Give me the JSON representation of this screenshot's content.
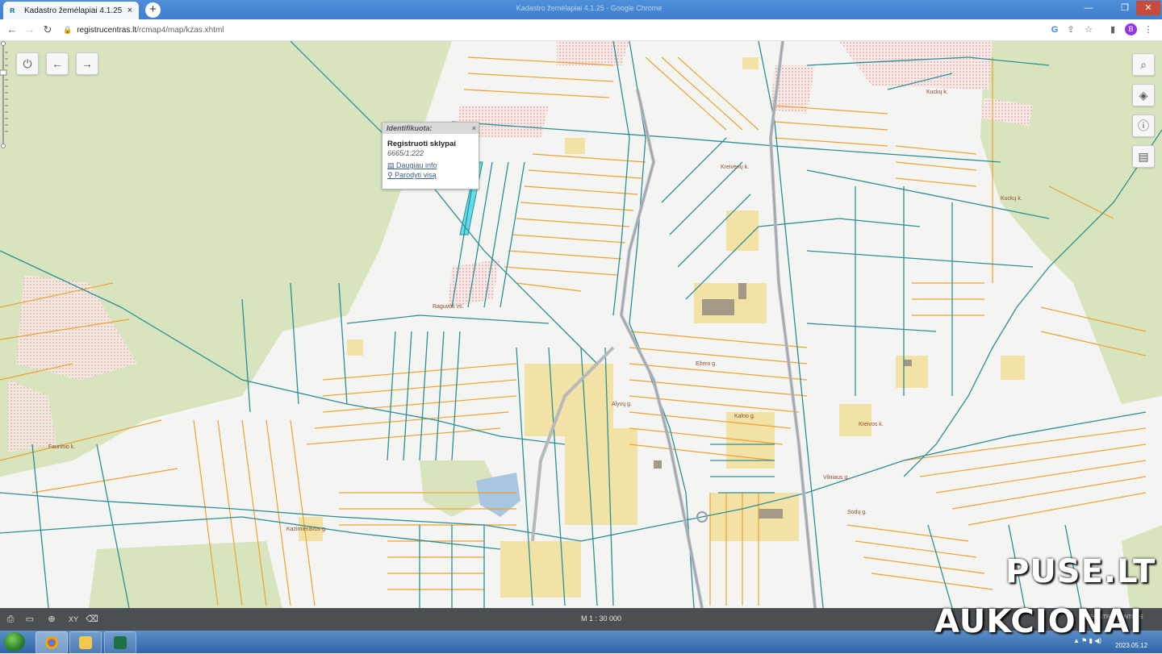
{
  "browser": {
    "tab_title": "Kadastro žemėlapiai 4.1.25",
    "tab_close": "×",
    "new_tab": "+",
    "window_title": "Kadastro žemėlapiai 4.1.25 - Google Chrome",
    "url_host": "registrucentras.lt",
    "url_path": "/rcmap4/map/kzas.xhtml",
    "profile_initial": "B"
  },
  "popup": {
    "header": "Identifikuota:",
    "close": "×",
    "title": "Registruoti sklypai",
    "parcel_id": "6665/1:222",
    "link_more": "Daugiau info",
    "link_show": "Parodyti visą"
  },
  "map_labels": [
    "Raguvos vs.",
    "Kuckų k.",
    "Kuckų k.",
    "Kreivėnų k.",
    "Faurimo k.",
    "Kazimieravos g.",
    "Vilniaus g.",
    "Sodų g.",
    "Ežero g.",
    "Kreivos k.",
    "Alyvų g.",
    "Kalno g."
  ],
  "bottom_bar": {
    "scale": "M 1 : 30 000",
    "brand": "REGISTRŲ CENTRAS",
    "xy_label": "XY"
  },
  "taskbar": {
    "date": "2023.05.12"
  },
  "watermark": {
    "line1": "PUSE.LT",
    "line2": "AUKCIONAI"
  },
  "colors": {
    "parcel_teal": "#2a8f94",
    "parcel_orange": "#f0a030",
    "forest": "#d8e4be",
    "buildings": "#f3e2a6",
    "highlight": "#62dcea"
  }
}
